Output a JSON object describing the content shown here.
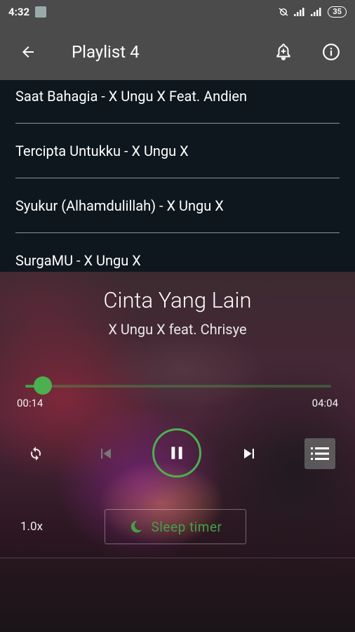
{
  "status_bar": {
    "time": "4:32",
    "battery": "35"
  },
  "app_bar": {
    "title": "Playlist 4"
  },
  "playlist": {
    "items": [
      {
        "label": "Saat Bahagia - X Ungu X Feat. Andien"
      },
      {
        "label": "Tercipta Untukku - X Ungu X"
      },
      {
        "label": "Syukur (Alhamdulillah) - X Ungu X"
      },
      {
        "label": "SurgaMU - X Ungu X"
      }
    ]
  },
  "player": {
    "title": "Cinta Yang Lain",
    "artist": "X Ungu X feat. Chrisye",
    "elapsed": "00:14",
    "duration": "04:04",
    "progress_fraction": 0.057,
    "speed": "1.0x",
    "sleep_timer_label": "Sleep timer",
    "accent_color": "#4caf50"
  },
  "icons": {
    "back": "arrow-back-icon",
    "bell": "bell-add-icon",
    "info": "info-icon",
    "repeat": "repeat-icon",
    "previous": "skip-previous-icon",
    "pause": "pause-icon",
    "next": "skip-next-icon",
    "queue": "queue-list-icon",
    "moon": "moon-icon"
  }
}
